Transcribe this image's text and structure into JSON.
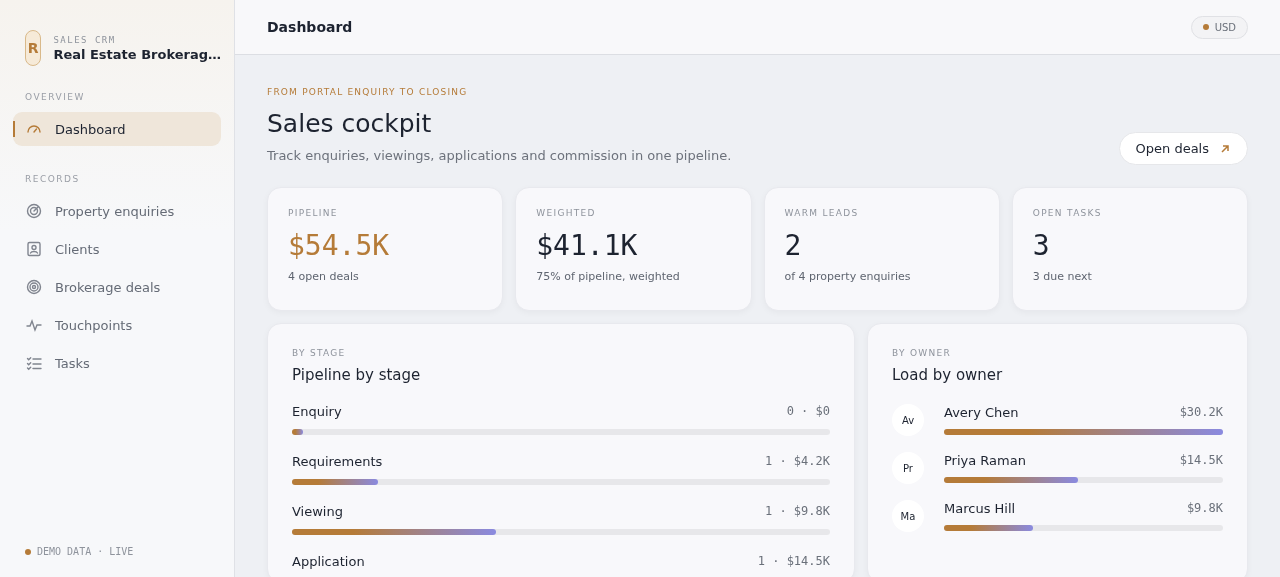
{
  "sidebar": {
    "brand": {
      "initial": "R",
      "kicker": "SALES CRM",
      "name": "Real Estate Brokerag…"
    },
    "sections": [
      {
        "title": "OVERVIEW",
        "items": [
          {
            "label": "Dashboard",
            "selected": true
          }
        ]
      },
      {
        "title": "RECORDS",
        "items": [
          {
            "label": "Property enquiries",
            "selected": false
          },
          {
            "label": "Clients",
            "selected": false
          },
          {
            "label": "Brokerage deals",
            "selected": false
          },
          {
            "label": "Touchpoints",
            "selected": false
          },
          {
            "label": "Tasks",
            "selected": false
          }
        ]
      }
    ],
    "status": "DEMO DATA · LIVE"
  },
  "topbar": {
    "title": "Dashboard",
    "currency": "USD"
  },
  "header": {
    "eyebrow": "FROM PORTAL ENQUIRY TO CLOSING",
    "title": "Sales cockpit",
    "subtitle": "Track enquiries, viewings, applications and commission in one pipeline.",
    "action": "Open deals"
  },
  "kpis": [
    {
      "label": "PIPELINE",
      "value": "$54.5K",
      "note": "4 open deals",
      "accent": true
    },
    {
      "label": "WEIGHTED",
      "value": "$41.1K",
      "note": "75% of pipeline, weighted",
      "accent": false
    },
    {
      "label": "WARM LEADS",
      "value": "2",
      "note": "of 4 property enquiries",
      "accent": false
    },
    {
      "label": "OPEN TASKS",
      "value": "3",
      "note": "3 due next",
      "accent": false
    }
  ],
  "stages": {
    "kicker": "BY STAGE",
    "title": "Pipeline by stage",
    "rows": [
      {
        "name": "Enquiry",
        "reading": "0 · $0",
        "level": 0.02
      },
      {
        "name": "Requirements",
        "reading": "1 · $4.2K",
        "level": 0.16
      },
      {
        "name": "Viewing",
        "reading": "1 · $9.8K",
        "level": 0.38
      },
      {
        "name": "Application",
        "reading": "1 · $14.5K"
      }
    ]
  },
  "owners": {
    "kicker": "BY OWNER",
    "title": "Load by owner",
    "rows": [
      {
        "initials": "Av",
        "name": "Avery Chen",
        "reading": "$30.2K",
        "level": 1.0
      },
      {
        "initials": "Pr",
        "name": "Priya Raman",
        "reading": "$14.5K",
        "level": 0.48
      },
      {
        "initials": "Ma",
        "name": "Marcus Hill",
        "reading": "$9.8K",
        "level": 0.32
      }
    ]
  }
}
